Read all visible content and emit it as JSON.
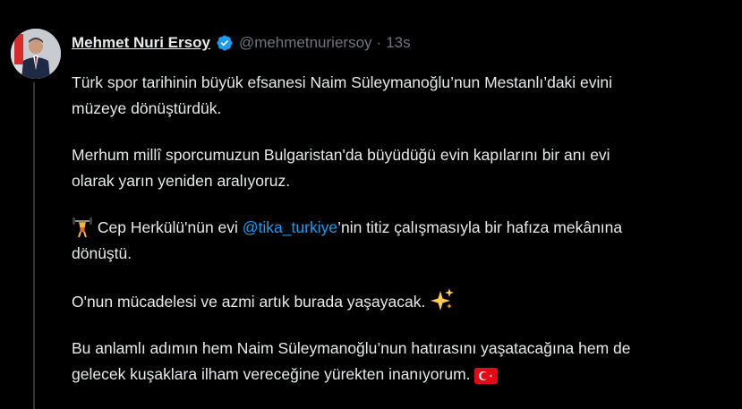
{
  "tweet": {
    "author_name": "Mehmet Nuri Ersoy",
    "handle": "@mehmetnuriersoy",
    "separator": "·",
    "time": "13s",
    "paragraphs": {
      "p1_line1": "Türk spor tarihinin büyük efsanesi Naim Süleymanoğlu’nun Mestanlı’daki evini",
      "p1_line2": "müzeye dönüştürdük.",
      "p2_line1": "Merhum millî sporcumuzun Bulgaristan'da büyüdüğü evin kapılarını bir anı evi",
      "p2_line2": "olarak yarın yeniden aralıyoruz.",
      "p3_pre": "Cep Herkülü'nün evi",
      "p3_mention": "@tika_turkiye",
      "p3_post": "’nin titiz çalışmasıyla bir hafıza mekânına",
      "p3_line2": "dönüştü.",
      "p4": "O'nun mücadelesi ve azmi artık burada yaşayacak.",
      "p5_line1": "Bu anlamlı adımın hem Naim Süleymanoğlu’nun hatırasını yaşatacağına hem de",
      "p5_line2": "gelecek kuşaklara ilham vereceğine yürekten inanıyorum."
    },
    "icons": {
      "verified": "verified-badge-icon",
      "weightlifter": "weightlifter-emoji",
      "sparkles": "sparkles-emoji",
      "flag": "turkey-flag-emoji"
    },
    "colors": {
      "background": "#000000",
      "text": "#e7e9ea",
      "secondary": "#71767b",
      "link": "#1d9bf0",
      "verified": "#1d9bf0"
    }
  }
}
